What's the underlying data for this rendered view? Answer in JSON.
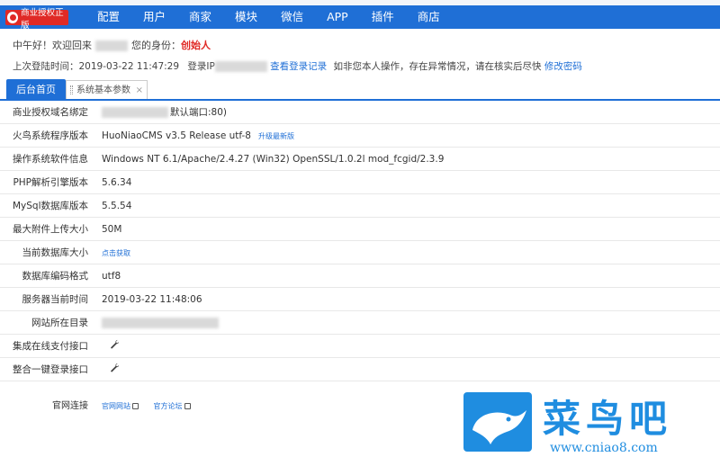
{
  "header": {
    "logo_text": "商业授权正版",
    "nav": [
      "配置",
      "用户",
      "商家",
      "模块",
      "微信",
      "APP",
      "插件",
      "商店"
    ]
  },
  "greeting": {
    "prefix": "中午好！欢迎回来",
    "role_label": "您的身份：",
    "role": "创始人"
  },
  "last_login": {
    "label": "上次登陆时间：",
    "time": "2019-03-22 11:47:29",
    "ip_label": "登录IP",
    "view_link": "查看登录记录",
    "notice": "如非您本人操作，存在异常情况，请在核实后尽快",
    "change_pwd": "修改密码"
  },
  "tabs": {
    "active": "后台首页",
    "second": "系统基本参数",
    "close": "×"
  },
  "info": {
    "rows": [
      {
        "label": "商业授权域名绑定",
        "value": "默认端口:80)"
      },
      {
        "label": "火鸟系统程序版本",
        "value": "HuoNiaoCMS v3.5 Release utf-8",
        "link": "升级最新版"
      },
      {
        "label": "操作系统软件信息",
        "value": "Windows NT 6.1/Apache/2.4.27 (Win32) OpenSSL/1.0.2l mod_fcgid/2.3.9"
      },
      {
        "label": "PHP解析引擎版本",
        "value": "5.6.34"
      },
      {
        "label": "MySql数据库版本",
        "value": "5.5.54"
      },
      {
        "label": "最大附件上传大小",
        "value": "50M"
      },
      {
        "label": "当前数据库大小",
        "link": "点击获取"
      },
      {
        "label": "数据库编码格式",
        "value": "utf8"
      },
      {
        "label": "服务器当前时间",
        "value": "2019-03-22 11:48:06"
      },
      {
        "label": "网站所在目录",
        "value": ""
      },
      {
        "label": "集成在线支付接口",
        "icon": "wrench-icon"
      },
      {
        "label": "整合一键登录接口",
        "icon": "wrench-icon"
      }
    ]
  },
  "footer": {
    "label": "官网连接",
    "link1": "官网网站",
    "link2": "官方论坛"
  },
  "watermark": {
    "text": "菜鸟吧",
    "url": "www.cniao8.com"
  }
}
